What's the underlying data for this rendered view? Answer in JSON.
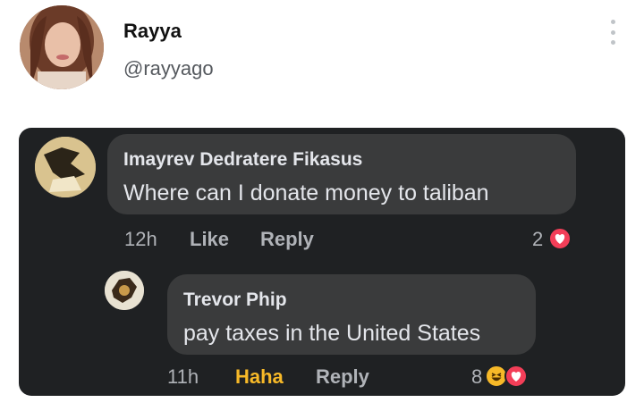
{
  "tweet": {
    "display_name": "Rayya",
    "handle": "@rayyago"
  },
  "comments": [
    {
      "author": "Imayrev Dedratere Fikasus",
      "text": "Where can I donate money to taliban",
      "time": "12h",
      "actions": [
        "Like",
        "Reply"
      ],
      "reaction_count": "2",
      "reactions": [
        "heart-icon"
      ]
    },
    {
      "author": "Trevor Phip",
      "text": "pay taxes in the United States",
      "time": "11h",
      "actions": [
        "Haha",
        "Reply"
      ],
      "reaction_count": "8",
      "reactions": [
        "haha-icon",
        "heart-icon"
      ]
    }
  ],
  "colors": {
    "card_bg": "#1f2123",
    "bubble_bg": "#3a3b3c",
    "haha_active": "#f7b928",
    "heart": "#f33e58"
  }
}
